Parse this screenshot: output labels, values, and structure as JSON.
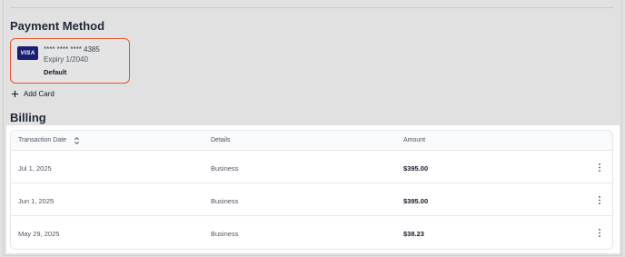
{
  "payment_method": {
    "title": "Payment Method",
    "card": {
      "brand": "VISA",
      "number": "**** **** **** 4385",
      "expiry": "Expiry 1/2040",
      "status": "Default",
      "highlight_color": "#e8542b",
      "brand_color": "#1a1f71"
    },
    "add_card_label": "Add Card"
  },
  "billing": {
    "title": "Billing",
    "columns": [
      "Transaction Date",
      "Details",
      "Amount"
    ],
    "rows": [
      {
        "date": "Jul 1, 2025",
        "details": "Business",
        "amount": "$395.00"
      },
      {
        "date": "Jun 1, 2025",
        "details": "Business",
        "amount": "$395.00"
      },
      {
        "date": "May 29, 2025",
        "details": "Business",
        "amount": "$38.23"
      }
    ]
  },
  "icons": {
    "add": "plus-icon",
    "sort": "sort-icon",
    "row_menu": "kebab-menu-icon"
  }
}
